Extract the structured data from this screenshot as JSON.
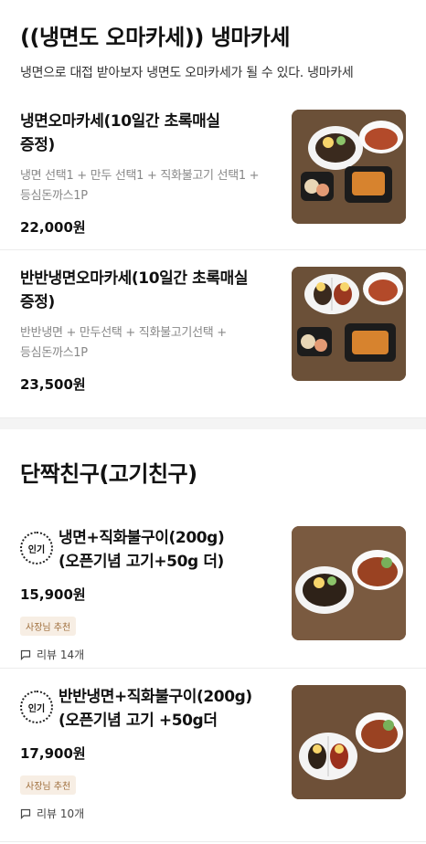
{
  "section1": {
    "title": "((냉면도 오마카세)) 냉마카세",
    "desc": "냉면으로 대접 받아보자 냉면도 오마카세가 될 수 있다. 냉마카세"
  },
  "items1": [
    {
      "name_line1": "냉면오마카세(10일간 초록매실",
      "name_line2": "증정)",
      "desc_line1": "냉면 선택1 + 만두 선택1 + 직화불고기 선택1 +",
      "desc_line2": "등심돈까스1P",
      "price": "22,000원"
    },
    {
      "name_line1": "반반냉면오마카세(10일간 초록매실",
      "name_line2": "증정)",
      "desc_line1": "반반냉면 + 만두선택 + 직화불고기선택 +",
      "desc_line2": "등심돈까스1P",
      "price": "23,500원"
    }
  ],
  "section2": {
    "title": "단짝친구(고기친구)"
  },
  "items2": [
    {
      "badge": "인기",
      "name_line1": "냉면+직화불구이(200g)",
      "name_line2": "(오픈기념 고기+50g 더)",
      "price": "15,900원",
      "tag": "사장님 추천",
      "review": "리뷰 14개"
    },
    {
      "badge": "인기",
      "name_line1": "반반냉면+직화불구이(200g)",
      "name_line2": "(오픈기념 고기 +50g더",
      "price": "17,900원",
      "tag": "사장님 추천",
      "review": "리뷰 10개"
    }
  ],
  "colors": {
    "tag_text": "#a0703e",
    "tag_bg": "#f7eee4",
    "divider": "#f4f4f4"
  }
}
